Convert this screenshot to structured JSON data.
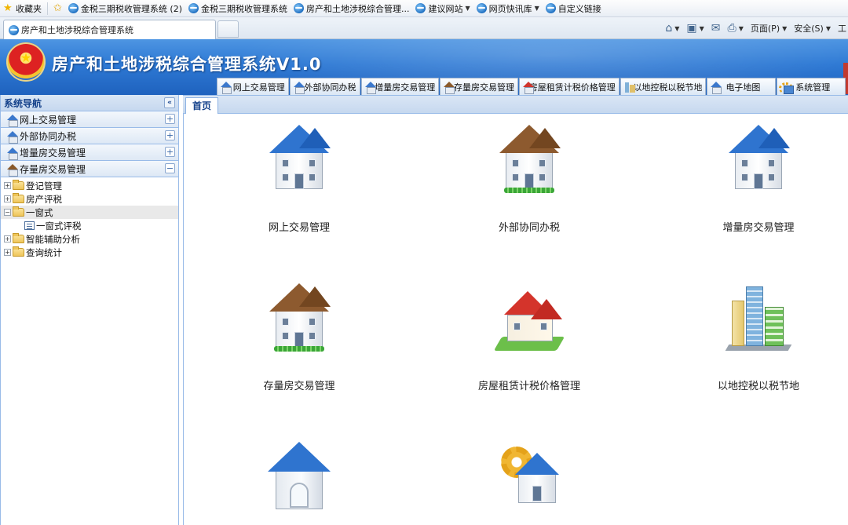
{
  "browser": {
    "favorites_bar": {
      "favorites_label": "收藏夹",
      "links": [
        {
          "label": "金税三期税收管理系统 (2)"
        },
        {
          "label": "金税三期税收管理系统"
        },
        {
          "label": "房产和土地涉税综合管理..."
        },
        {
          "label": "建议网站",
          "dropdown": true
        },
        {
          "label": "网页快讯库",
          "dropdown": true
        },
        {
          "label": "自定义链接"
        }
      ]
    },
    "tab": {
      "title": "房产和土地涉税综合管理系统"
    },
    "command_bar": {
      "page_label": "页面(P)",
      "safety_label": "安全(S)",
      "tools_label": "工"
    }
  },
  "app": {
    "title": "房产和土地涉税综合管理系统V1.0",
    "top_nav": [
      {
        "label": "网上交易管理",
        "icon": "house-icon"
      },
      {
        "label": "外部协同办税",
        "icon": "house-icon"
      },
      {
        "label": "增量房交易管理",
        "icon": "house-icon"
      },
      {
        "label": "存量房交易管理",
        "icon": "brown-house-icon"
      },
      {
        "label": "房屋租赁计税价格管理",
        "icon": "red-house-icon"
      },
      {
        "label": "以地控税以税节地",
        "icon": "buildings-icon"
      },
      {
        "label": "电子地图",
        "icon": "house-icon"
      },
      {
        "label": "系统管理",
        "icon": "gear-house-icon"
      }
    ]
  },
  "sidebar": {
    "title": "系统导航",
    "collapse_glyph": "«",
    "panels": [
      {
        "label": "网上交易管理",
        "state": "+"
      },
      {
        "label": "外部协同办税",
        "state": "+"
      },
      {
        "label": "增量房交易管理",
        "state": "+"
      },
      {
        "label": "存量房交易管理",
        "state": "−"
      }
    ],
    "tree": [
      {
        "label": "登记管理",
        "toggle": "+",
        "type": "folder",
        "level": 0
      },
      {
        "label": "房产评税",
        "toggle": "+",
        "type": "folder",
        "level": 0
      },
      {
        "label": "一窗式",
        "toggle": "−",
        "type": "folder",
        "level": 0,
        "selected": true
      },
      {
        "label": "一窗式评税",
        "type": "doc",
        "level": 1
      },
      {
        "label": "智能辅助分析",
        "toggle": "+",
        "type": "folder",
        "level": 0
      },
      {
        "label": "查询统计",
        "toggle": "+",
        "type": "folder",
        "level": 0
      }
    ]
  },
  "main": {
    "home_tab": "首页",
    "tiles": [
      {
        "label": "网上交易管理",
        "icon": "blue-house-icon"
      },
      {
        "label": "外部协同办税",
        "icon": "brown-house-icon"
      },
      {
        "label": "增量房交易管理",
        "icon": "blue-house-icon"
      },
      {
        "label": "存量房交易管理",
        "icon": "brown-house-icon"
      },
      {
        "label": "房屋租赁计税价格管理",
        "icon": "red-house-icon"
      },
      {
        "label": "以地控税以税节地",
        "icon": "buildings-icon"
      },
      {
        "label": "",
        "icon": "arch-house-icon"
      },
      {
        "label": "",
        "icon": "gear-house-icon"
      }
    ]
  }
}
